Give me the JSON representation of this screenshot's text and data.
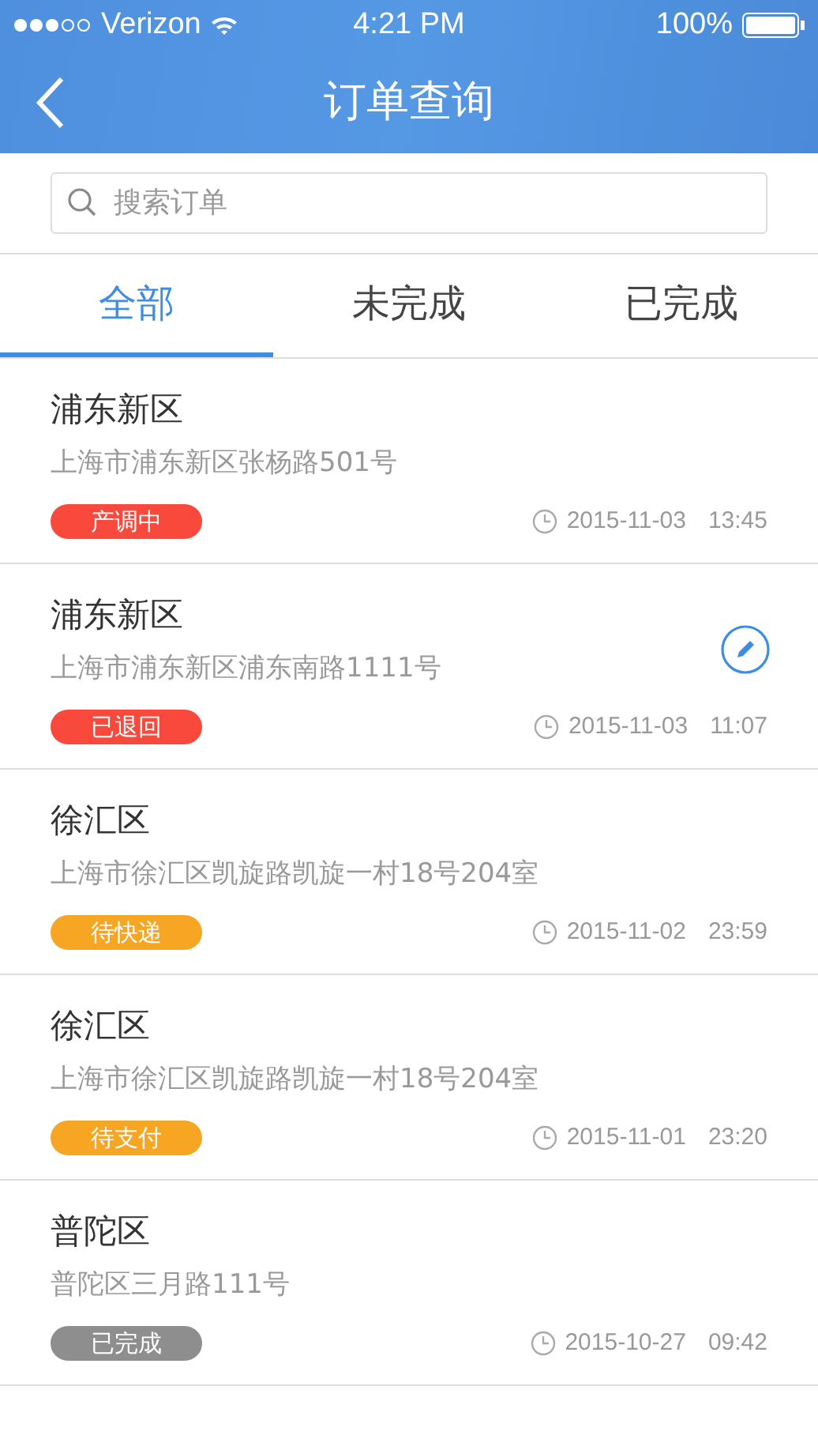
{
  "status_bar": {
    "carrier": "Verizon",
    "time": "4:21 PM",
    "battery": "100%"
  },
  "nav": {
    "title": "订单查询"
  },
  "search": {
    "placeholder": "搜索订单"
  },
  "tabs": [
    {
      "label": "全部",
      "selected": true
    },
    {
      "label": "未完成",
      "selected": false
    },
    {
      "label": "已完成",
      "selected": false
    }
  ],
  "orders": [
    {
      "district": "浦东新区",
      "address": "上海市浦东新区张杨路501号",
      "status": "产调中",
      "color": "#f9493c",
      "date": "2015-11-03",
      "time": "13:45",
      "editable": false
    },
    {
      "district": "浦东新区",
      "address": "上海市浦东新区浦东南路1111号",
      "status": "已退回",
      "color": "#f9493c",
      "date": "2015-11-03",
      "time": "11:07",
      "editable": true
    },
    {
      "district": "徐汇区",
      "address": "上海市徐汇区凯旋路凯旋一村18号204室",
      "status": "待快递",
      "color": "#f6a623",
      "date": "2015-11-02",
      "time": "23:59",
      "editable": false
    },
    {
      "district": "徐汇区",
      "address": "上海市徐汇区凯旋路凯旋一村18号204室",
      "status": "待支付",
      "color": "#f6a623",
      "date": "2015-11-01",
      "time": "23:20",
      "editable": false
    },
    {
      "district": "普陀区",
      "address": "普陀区三月路111号",
      "status": "已完成",
      "color": "#8e8e8e",
      "date": "2015-10-27",
      "time": "09:42",
      "editable": false
    }
  ]
}
